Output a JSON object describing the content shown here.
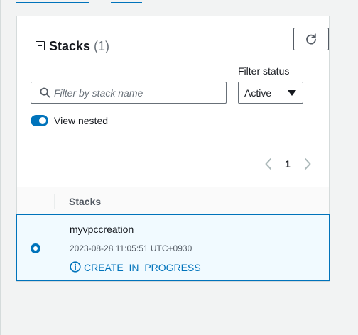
{
  "panel": {
    "title": "Stacks",
    "count": "(1)",
    "filter_status_label": "Filter status",
    "search": {
      "placeholder": "Filter by stack name",
      "value": ""
    },
    "status_select": {
      "value": "Active"
    },
    "toggle": {
      "label": "View nested",
      "checked": true
    },
    "pagination": {
      "current_page": "1"
    },
    "table": {
      "columns": [
        "Stacks"
      ],
      "rows": [
        {
          "name": "myvpccreation",
          "created": "2023-08-28 11:05:51 UTC+0930",
          "status": "CREATE_IN_PROGRESS",
          "selected": true
        }
      ]
    }
  },
  "icons": {
    "collapse": "collapse-icon",
    "refresh": "refresh-icon",
    "search": "search-icon",
    "caret": "caret-down-icon",
    "prev": "chevron-left-icon",
    "next": "chevron-right-icon",
    "info": "info-icon"
  },
  "colors": {
    "accent": "#0073bb",
    "selected_row_bg": "#f1faff",
    "text": "#16191f",
    "muted": "#687078",
    "page_bg": "#f2f3f3"
  }
}
